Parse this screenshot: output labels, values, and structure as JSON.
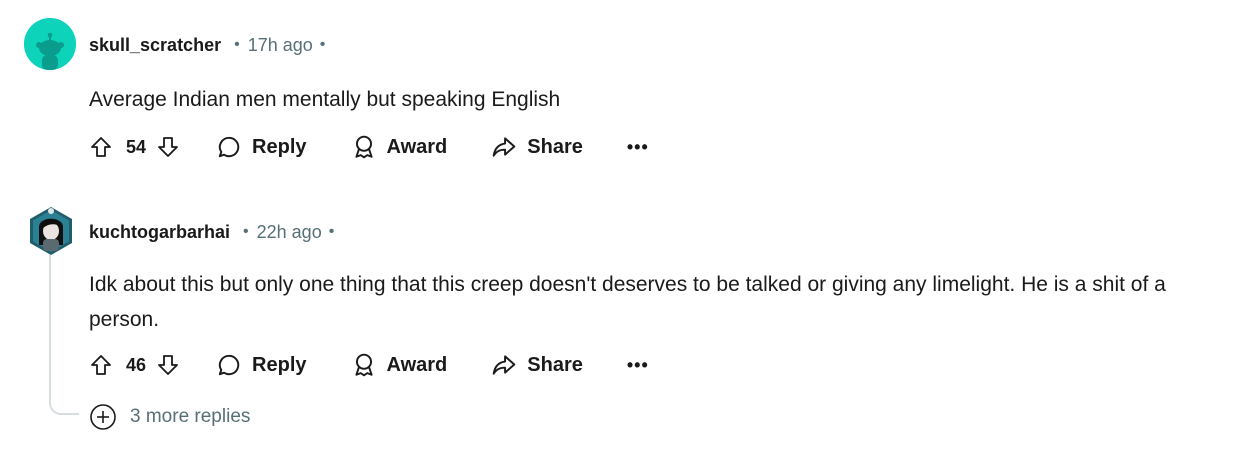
{
  "comments": [
    {
      "username": "skull_scratcher",
      "time": "17h ago",
      "body": "Average Indian men mentally but speaking English",
      "votes": "54",
      "reply_label": "Reply",
      "award_label": "Award",
      "share_label": "Share",
      "more_label": "•••"
    },
    {
      "username": "kuchtogarbarhai",
      "time": "22h ago",
      "body": "Idk about this but only one thing that this creep doesn't deserves to be talked or giving any limelight. He is a shit of a person.",
      "votes": "46",
      "reply_label": "Reply",
      "award_label": "Award",
      "share_label": "Share",
      "more_label": "•••"
    }
  ],
  "separator": "•",
  "more_replies": "3 more replies",
  "colors": {
    "avatar_teal": "#0dd3bb",
    "meta_gray": "#576f76",
    "text": "#1a1a1b",
    "thread_line": "#d8dde0"
  },
  "icons": [
    "upvote-icon",
    "downvote-icon",
    "comment-icon",
    "award-icon",
    "share-icon",
    "plus-circle-icon"
  ]
}
